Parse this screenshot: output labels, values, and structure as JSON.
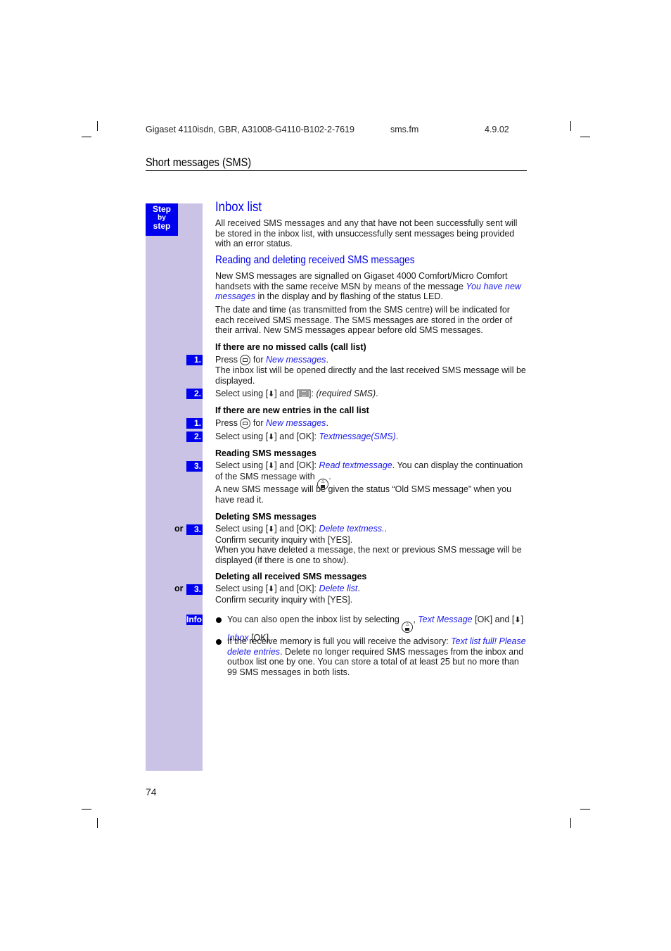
{
  "header": {
    "document_id": "Gigaset 4110isdn, GBR, A31008-G4110-B102-2-7619",
    "file_name": "sms.fm",
    "date": "4.9.02"
  },
  "section_title": "Short messages (SMS)",
  "sidebar": {
    "step_badge": {
      "line1": "Step",
      "line2": "by",
      "line3": "step"
    },
    "info_label": "Info",
    "or_label": "or"
  },
  "main": {
    "title": "Inbox list",
    "intro": "All received SMS messages and any that have not been successfully sent will be stored in the inbox list, with unsuccessfully sent messages being provided with an error status.",
    "subtitle": "Reading and deleting received SMS messages",
    "para1_before": "New SMS messages are signalled on Gigaset 4000 Comfort/Micro Comfort handsets with the same receive MSN by means of the message ",
    "para1_term": "You have new messages",
    "para1_after": " in the display and by flashing of the status LED.",
    "para2": "The date and time (as transmitted from the SMS centre) will be indicated for each received SMS message. The SMS messages are stored in the order of their arrival. New SMS messages appear before old SMS messages.",
    "block_no_missed": {
      "heading": "If there are  no missed calls (call list)",
      "step1": {
        "num": "1.",
        "before": "Press ",
        "mid": " for ",
        "term": "New messages",
        "after": ".",
        "note": "The inbox list will be opened directly and the last received SMS message will be displayed."
      },
      "step2": {
        "num": "2.",
        "before": "Select using [",
        "mid": "] and [",
        "after": "]: ",
        "term": "(required SMS)",
        "end": "."
      }
    },
    "block_new_entries": {
      "heading": "If there are new entries in the call list",
      "step1": {
        "num": "1.",
        "before": "Press ",
        "mid": " for ",
        "term": "New messages",
        "after": "."
      },
      "step2": {
        "num": "2.",
        "before": "Select using [",
        "after": "] and [OK]: ",
        "term": "Textmessage(SMS)",
        "end": "."
      }
    },
    "block_reading": {
      "heading": "Reading SMS messages",
      "step3": {
        "num": "3.",
        "before": "Select using [",
        "after": "] and [OK]: ",
        "term": "Read textmessage",
        "end": ". You can display the continuation of the SMS message with ",
        "end2": "."
      },
      "note": "A new SMS message will be given the status “Old SMS message” when you have read it."
    },
    "block_deleting": {
      "heading": "Deleting SMS messages",
      "step3": {
        "num": "3.",
        "before": "Select using [",
        "after": "] and [OK]: ",
        "term": "Delete textmess.",
        "end": "."
      },
      "confirm": "Confirm security inquiry with [YES].",
      "note": "When you have deleted a message, the next or previous SMS message will be displayed (if there is one to show)."
    },
    "block_deleting_all": {
      "heading": "Deleting all received SMS messages",
      "step3": {
        "num": "3.",
        "before": "Select using [",
        "after": "] and [OK]: ",
        "term": "Delete list",
        "end": "."
      },
      "confirm": "Confirm security inquiry with [YES]."
    },
    "info": {
      "bullet1": {
        "before": "You can also open the inbox list by selecting ",
        "sep": ", ",
        "term1": "Text Message",
        "mid": " [OK] and [",
        "mid2": "] ",
        "term2": "Inbox",
        "end": " [OK]."
      },
      "bullet2": {
        "before": "If the receive memory is full you will receive the advisory: ",
        "term": "Text list full! Please delete entries",
        "after": ". Delete no longer required SMS messages from the inbox and outbox list one by one. You can store a total of at least 25 but no more than 99 SMS messages in both lists."
      }
    }
  },
  "icons": {
    "down_arrow": "⬇",
    "nav_up": "△"
  },
  "page_number": "74",
  "colors": {
    "accent": "#0000ee",
    "sidebar": "#cbc3e5",
    "term": "#1a1aee"
  }
}
